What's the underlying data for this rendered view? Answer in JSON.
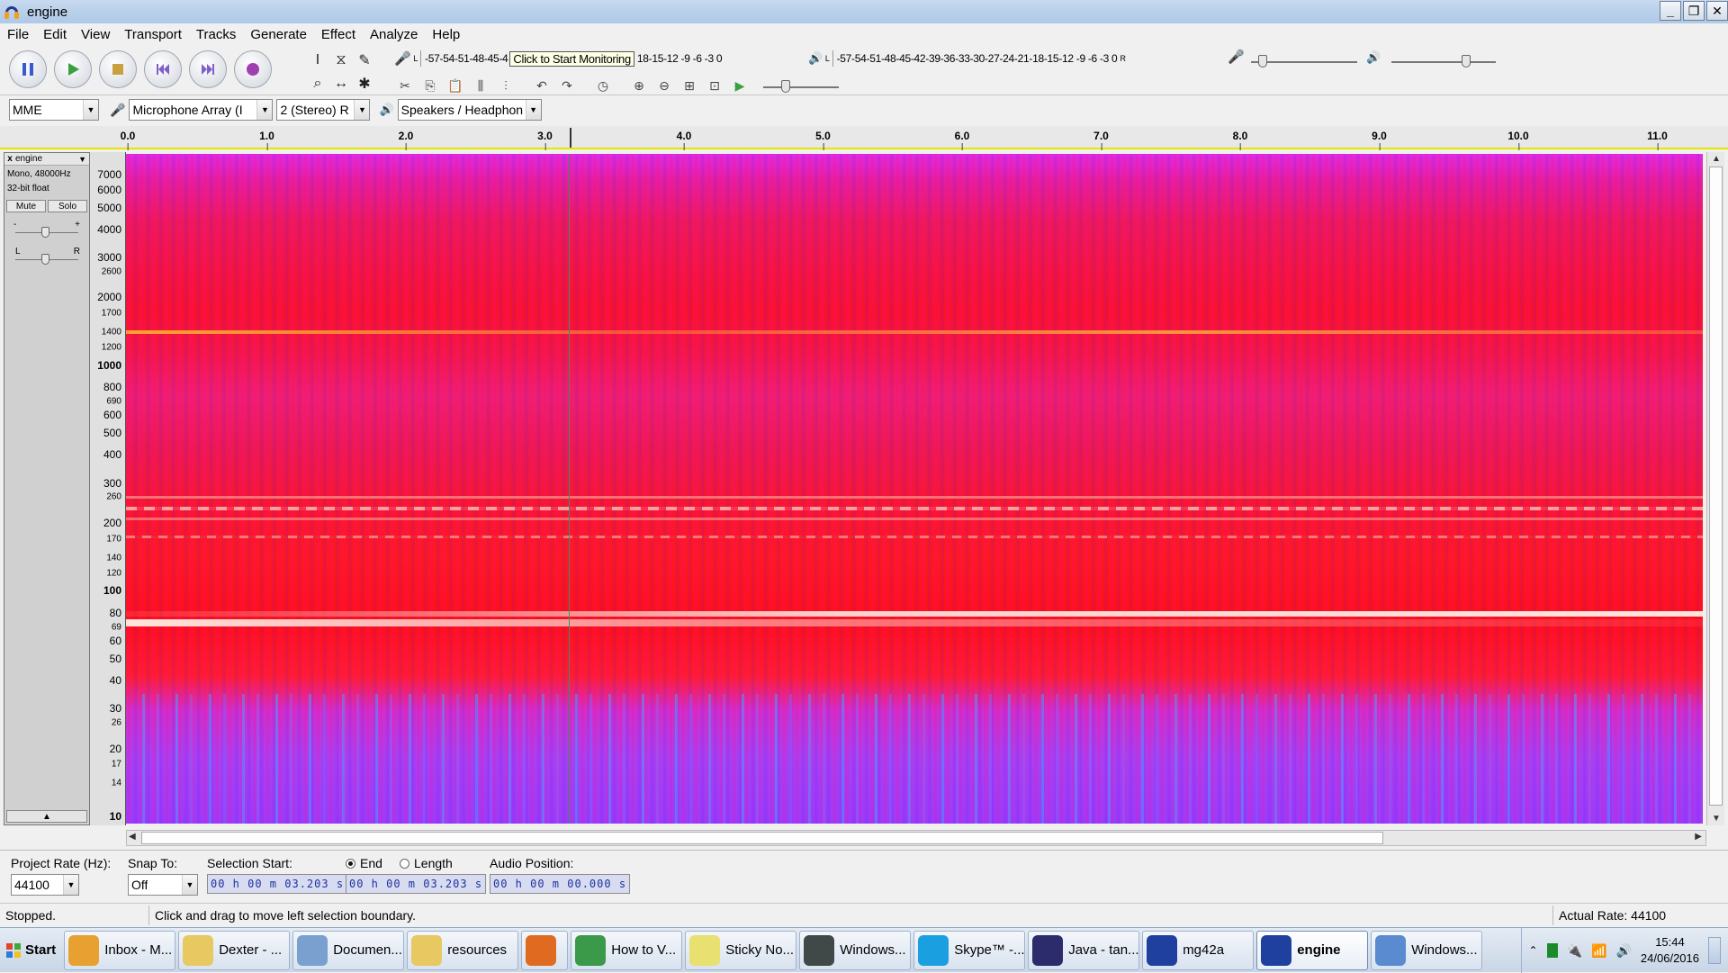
{
  "window": {
    "title": "engine",
    "controls": [
      "_",
      "❐",
      "✕"
    ]
  },
  "menu": [
    "File",
    "Edit",
    "View",
    "Transport",
    "Tracks",
    "Generate",
    "Effect",
    "Analyze",
    "Help"
  ],
  "meters": {
    "record_ticks": "-57-54-51-48-45-4",
    "monitor_tip": "Click to Start Monitoring",
    "record_ticks_tail": "18-15-12 -9 -6 -3 0",
    "play_ticks": "-57-54-51-48-45-42-39-36-33-30-27-24-21-18-15-12 -9 -6 -3 0",
    "channel_l": "L",
    "channel_r": "R"
  },
  "device_toolbar": {
    "host": "MME",
    "input_device": "Microphone Array (I",
    "input_channels": "2 (Stereo) R",
    "output_device": "Speakers / Headphon"
  },
  "timeline": {
    "ticks": [
      {
        "label": "0.0",
        "x": 0.0
      },
      {
        "label": "1.0",
        "x": 1.0
      },
      {
        "label": "2.0",
        "x": 2.0
      },
      {
        "label": "3.0",
        "x": 3.0
      },
      {
        "label": "4.0",
        "x": 4.0
      },
      {
        "label": "5.0",
        "x": 5.0
      },
      {
        "label": "6.0",
        "x": 6.0
      },
      {
        "label": "7.0",
        "x": 7.0
      },
      {
        "label": "8.0",
        "x": 8.0
      },
      {
        "label": "9.0",
        "x": 9.0
      },
      {
        "label": "10.0",
        "x": 10.0
      },
      {
        "label": "11.0",
        "x": 11.0
      }
    ]
  },
  "track": {
    "name": "engine",
    "format": "Mono, 48000Hz",
    "sample_format": "32-bit float",
    "mute_label": "Mute",
    "solo_label": "Solo",
    "gain_minus": "-",
    "gain_plus": "+",
    "pan_left": "L",
    "pan_right": "R"
  },
  "freq_axis": [
    {
      "label": "7000",
      "hz": 7000,
      "bold": false,
      "small": false
    },
    {
      "label": "6000",
      "hz": 6000,
      "bold": false,
      "small": false
    },
    {
      "label": "5000",
      "hz": 5000,
      "bold": false,
      "small": false
    },
    {
      "label": "4000",
      "hz": 4000,
      "bold": false,
      "small": false
    },
    {
      "label": "3000",
      "hz": 3000,
      "bold": false,
      "small": false
    },
    {
      "label": "2600",
      "hz": 2600,
      "bold": false,
      "small": true
    },
    {
      "label": "2000",
      "hz": 2000,
      "bold": false,
      "small": false
    },
    {
      "label": "1700",
      "hz": 1700,
      "bold": false,
      "small": true
    },
    {
      "label": "1400",
      "hz": 1400,
      "bold": false,
      "small": true
    },
    {
      "label": "1200",
      "hz": 1200,
      "bold": false,
      "small": true
    },
    {
      "label": "1000",
      "hz": 1000,
      "bold": true,
      "small": false
    },
    {
      "label": "800",
      "hz": 800,
      "bold": false,
      "small": false
    },
    {
      "label": "690",
      "hz": 690,
      "bold": false,
      "small": true
    },
    {
      "label": "600",
      "hz": 600,
      "bold": false,
      "small": false
    },
    {
      "label": "500",
      "hz": 500,
      "bold": false,
      "small": false
    },
    {
      "label": "400",
      "hz": 400,
      "bold": false,
      "small": false
    },
    {
      "label": "300",
      "hz": 300,
      "bold": false,
      "small": false
    },
    {
      "label": "260",
      "hz": 260,
      "bold": false,
      "small": true
    },
    {
      "label": "200",
      "hz": 200,
      "bold": false,
      "small": false
    },
    {
      "label": "170",
      "hz": 170,
      "bold": false,
      "small": true
    },
    {
      "label": "140",
      "hz": 140,
      "bold": false,
      "small": true
    },
    {
      "label": "120",
      "hz": 120,
      "bold": false,
      "small": true
    },
    {
      "label": "100",
      "hz": 100,
      "bold": true,
      "small": false
    },
    {
      "label": "80",
      "hz": 80,
      "bold": false,
      "small": false
    },
    {
      "label": "69",
      "hz": 69,
      "bold": false,
      "small": true
    },
    {
      "label": "60",
      "hz": 60,
      "bold": false,
      "small": false
    },
    {
      "label": "50",
      "hz": 50,
      "bold": false,
      "small": false
    },
    {
      "label": "40",
      "hz": 40,
      "bold": false,
      "small": false
    },
    {
      "label": "30",
      "hz": 30,
      "bold": false,
      "small": false
    },
    {
      "label": "26",
      "hz": 26,
      "bold": false,
      "small": true
    },
    {
      "label": "20",
      "hz": 20,
      "bold": false,
      "small": false
    },
    {
      "label": "17",
      "hz": 17,
      "bold": false,
      "small": true
    },
    {
      "label": "14",
      "hz": 14,
      "bold": false,
      "small": true
    },
    {
      "label": "10",
      "hz": 10,
      "bold": true,
      "small": false
    }
  ],
  "selection_toolbar": {
    "project_rate_label": "Project Rate (Hz):",
    "project_rate": "44100",
    "snap_label": "Snap To:",
    "snap_value": "Off",
    "selection_start_label": "Selection Start:",
    "end_label": "End",
    "length_label": "Length",
    "audio_position_label": "Audio Position:",
    "selection_start": "00 h 00 m 03.203 s",
    "selection_end": "00 h 00 m 03.203 s",
    "audio_position": "00 h 00 m 00.000 s"
  },
  "status": {
    "state": "Stopped.",
    "hint": "Click and drag to move left selection boundary.",
    "actual_rate": "Actual Rate: 44100"
  },
  "taskbar": {
    "start_label": "Start",
    "tasks": [
      {
        "label": "Inbox - M...",
        "icon": "outlook-icon",
        "color": "#e8a030",
        "active": false
      },
      {
        "label": "Dexter - ...",
        "icon": "folder-icon",
        "color": "#e8c860",
        "active": false
      },
      {
        "label": "Documen...",
        "icon": "document-icon",
        "color": "#7aa0d0",
        "active": false
      },
      {
        "label": "resources",
        "icon": "folder-icon",
        "color": "#e8c860",
        "active": false
      },
      {
        "label": "",
        "icon": "firefox-icon",
        "color": "#e06a20",
        "active": false
      },
      {
        "label": "How to V...",
        "icon": "chrome-icon",
        "color": "#3a9a4a",
        "active": false
      },
      {
        "label": "Sticky No...",
        "icon": "sticky-notes-icon",
        "color": "#e8e070",
        "active": false
      },
      {
        "label": "Windows...",
        "icon": "terminal-icon",
        "color": "#404848",
        "active": false
      },
      {
        "label": "Skype™ -...",
        "icon": "skype-icon",
        "color": "#1aa0e0",
        "active": false
      },
      {
        "label": "Java - tan...",
        "icon": "eclipse-icon",
        "color": "#2c2c6c",
        "active": false
      },
      {
        "label": "mg42a",
        "icon": "audacity-icon",
        "color": "#2040a0",
        "active": false
      },
      {
        "label": "engine",
        "icon": "audacity-icon",
        "color": "#2040a0",
        "active": true
      },
      {
        "label": "Windows...",
        "icon": "windows-explorer-icon",
        "color": "#5a8ad0",
        "active": false
      }
    ],
    "time": "15:44",
    "date": "24/06/2016"
  }
}
